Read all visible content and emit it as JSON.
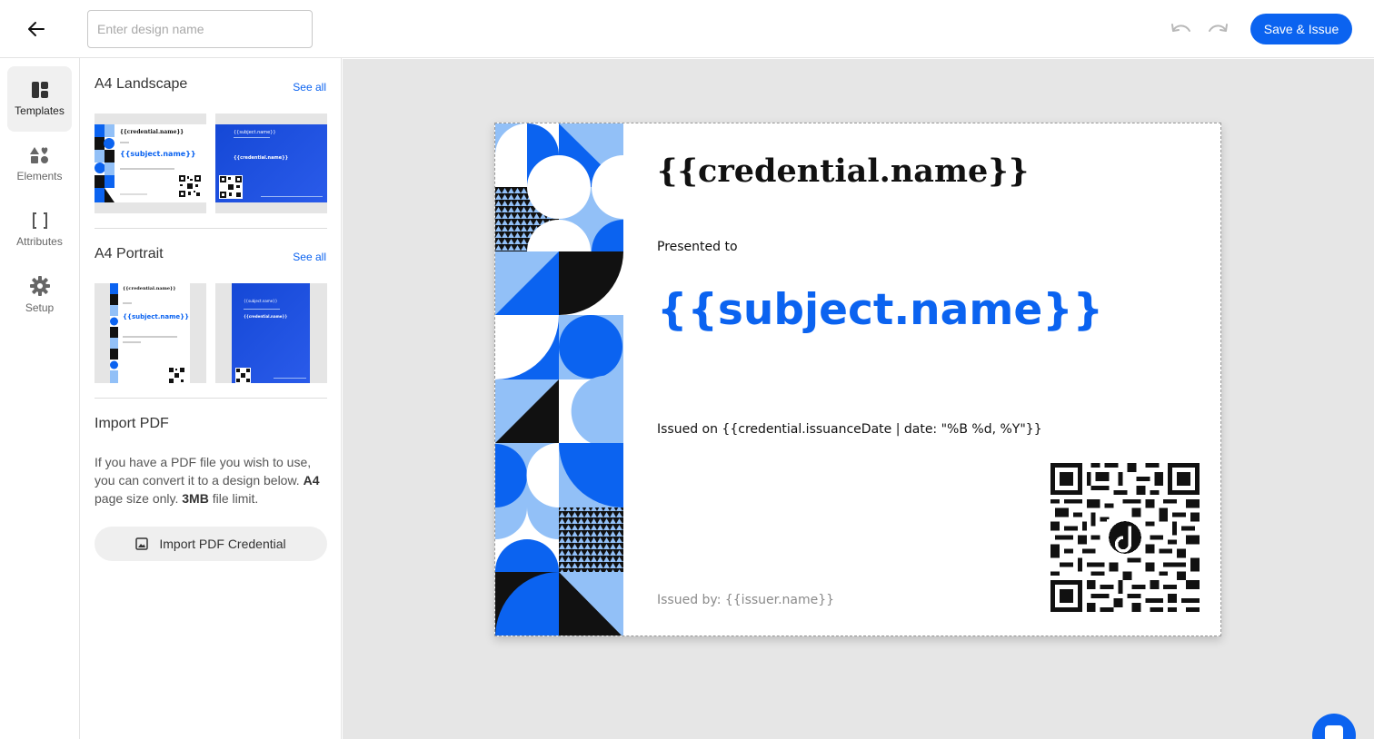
{
  "header": {
    "design_name_placeholder": "Enter design name",
    "design_name_value": "",
    "save_label": "Save & Issue",
    "icons": {
      "back": "arrow-left-icon",
      "undo": "undo-icon",
      "redo": "redo-icon"
    }
  },
  "rail": {
    "items": [
      {
        "label": "Templates",
        "icon": "template-layout-icon",
        "active": true
      },
      {
        "label": "Elements",
        "icon": "shapes-icon",
        "active": false
      },
      {
        "label": "Attributes",
        "icon": "brackets-icon",
        "active": false
      },
      {
        "label": "Setup",
        "icon": "gear-icon",
        "active": false
      }
    ]
  },
  "panel": {
    "landscape": {
      "title": "A4 Landscape",
      "see_all": "See all",
      "templates": [
        {
          "title_text": "{{credential.name}}",
          "subject_text": "{{subject.name}}",
          "style": "white-pattern"
        },
        {
          "title_text": "{{subject.name}}",
          "subject_text": "{{credential.name}}",
          "style": "blue"
        }
      ]
    },
    "portrait": {
      "title": "A4 Portrait",
      "see_all": "See all",
      "templates": [
        {
          "title_text": "{{credential.name}}",
          "subject_text": "{{subject.name}}",
          "style": "white-pattern"
        },
        {
          "title_text": "{{subject.name}}",
          "subject_text": "{{credential.name}}",
          "style": "blue"
        }
      ]
    },
    "import": {
      "title": "Import PDF",
      "description_1": "If you have a PDF file you wish to use, you can convert it to a design below.",
      "description_bold_1": "A4",
      "description_2": "page size only.",
      "description_bold_2": "3MB",
      "description_3": "file limit.",
      "button_label": "Import PDF Credential",
      "button_icon": "image-icon"
    }
  },
  "certificate": {
    "title": "{{credential.name}}",
    "presented_to": "Presented to",
    "subject": "{{subject.name}}",
    "issued_on": "Issued on {{credential.issuanceDate | date: \"%B %d, %Y\"}}",
    "issued_by": "Issued by: {{issuer.name}}"
  },
  "colors": {
    "accent": "#0b63f0",
    "light_blue": "#92c0f7",
    "canvas_bg": "#e6e6e6"
  }
}
